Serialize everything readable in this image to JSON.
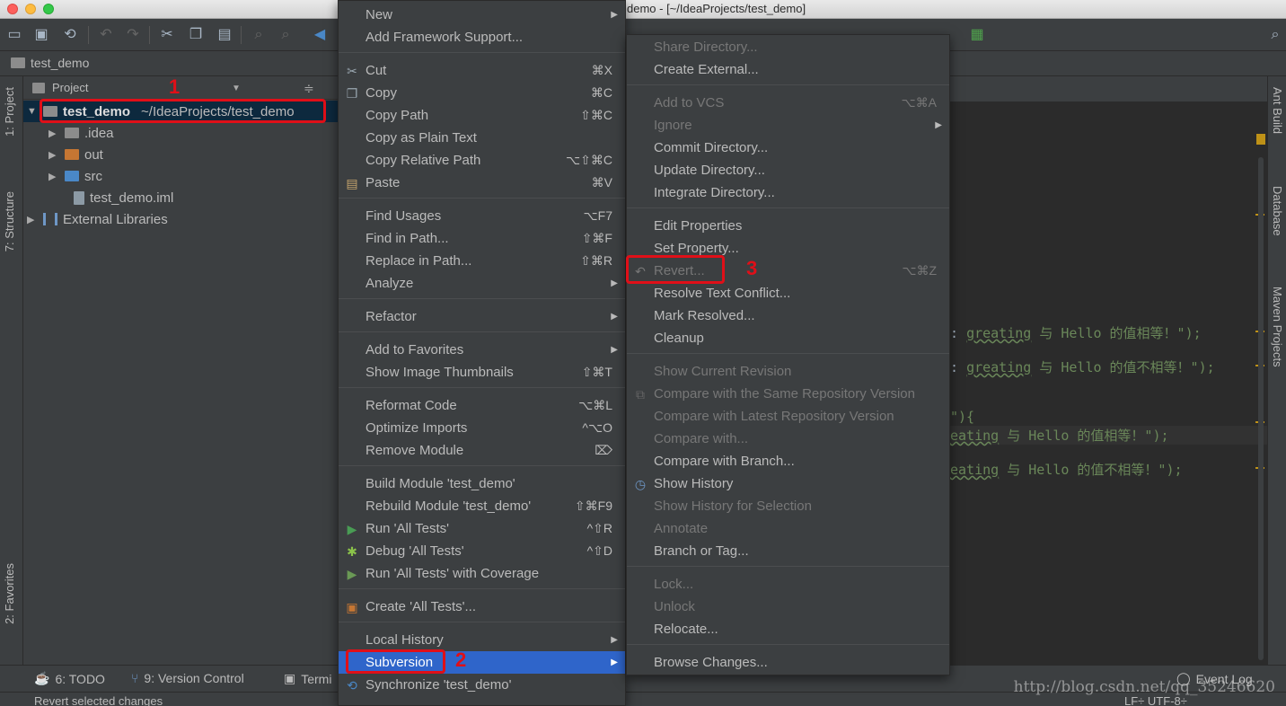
{
  "window": {
    "title": "demo - [~/IdeaProjects/test_demo]"
  },
  "navbar": {
    "crumb": "test_demo"
  },
  "left_strip": {
    "project_tab": "1: Project",
    "structure_tab": "7: Structure",
    "favorites_tab": "2: Favorites"
  },
  "right_strip": {
    "ant_tab": "Ant Build",
    "database_tab": "Database",
    "maven_tab": "Maven Projects"
  },
  "project": {
    "header": "Project",
    "root_name": "test_demo",
    "root_path": "~/IdeaProjects/test_demo",
    "items": [
      {
        "label": ".idea",
        "icon": "folder-icon"
      },
      {
        "label": "out",
        "icon": "folder-orange-icon"
      },
      {
        "label": "src",
        "icon": "folder-blue-icon"
      },
      {
        "label": "test_demo.iml",
        "icon": "iml-file-icon"
      },
      {
        "label": "External Libraries",
        "icon": "library-icon"
      }
    ]
  },
  "annotations": {
    "a1": "1",
    "a2": "2",
    "a3": "3"
  },
  "context_menu": {
    "new": {
      "label": "New"
    },
    "add_framework": {
      "label": "Add Framework Support..."
    },
    "cut": {
      "label": "Cut",
      "shortcut": "⌘X"
    },
    "copy": {
      "label": "Copy",
      "shortcut": "⌘C"
    },
    "copy_path": {
      "label": "Copy Path",
      "shortcut": "⇧⌘C"
    },
    "copy_plain": {
      "label": "Copy as Plain Text"
    },
    "copy_relative": {
      "label": "Copy Relative Path",
      "shortcut": "⌥⇧⌘C"
    },
    "paste": {
      "label": "Paste",
      "shortcut": "⌘V"
    },
    "find_usages": {
      "label": "Find Usages",
      "shortcut": "⌥F7"
    },
    "find_in_path": {
      "label": "Find in Path...",
      "shortcut": "⇧⌘F"
    },
    "replace_in_path": {
      "label": "Replace in Path...",
      "shortcut": "⇧⌘R"
    },
    "analyze": {
      "label": "Analyze"
    },
    "refactor": {
      "label": "Refactor"
    },
    "add_favorites": {
      "label": "Add to Favorites"
    },
    "show_thumbnails": {
      "label": "Show Image Thumbnails",
      "shortcut": "⇧⌘T"
    },
    "reformat": {
      "label": "Reformat Code",
      "shortcut": "⌥⌘L"
    },
    "optimize": {
      "label": "Optimize Imports",
      "shortcut": "^⌥O"
    },
    "remove_module": {
      "label": "Remove Module",
      "shortcut": "⌦"
    },
    "build_module": {
      "label": "Build Module 'test_demo'"
    },
    "rebuild_module": {
      "label": "Rebuild Module 'test_demo'",
      "shortcut": "⇧⌘F9"
    },
    "run_tests": {
      "label": "Run 'All Tests'",
      "shortcut": "^⇧R"
    },
    "debug_tests": {
      "label": "Debug 'All Tests'",
      "shortcut": "^⇧D"
    },
    "run_coverage": {
      "label": "Run 'All Tests' with Coverage"
    },
    "create_tests": {
      "label": "Create 'All Tests'..."
    },
    "local_history": {
      "label": "Local History"
    },
    "subversion": {
      "label": "Subversion"
    },
    "synchronize": {
      "label": "Synchronize 'test_demo'"
    }
  },
  "submenu": {
    "share_dir": {
      "label": "Share Directory..."
    },
    "create_external": {
      "label": "Create External..."
    },
    "add_to_vcs": {
      "label": "Add to VCS",
      "shortcut": "⌥⌘A"
    },
    "ignore": {
      "label": "Ignore"
    },
    "commit_dir": {
      "label": "Commit Directory..."
    },
    "update_dir": {
      "label": "Update Directory..."
    },
    "integrate_dir": {
      "label": "Integrate Directory..."
    },
    "edit_props": {
      "label": "Edit Properties"
    },
    "set_prop": {
      "label": "Set Property..."
    },
    "revert": {
      "label": "Revert...",
      "shortcut": "⌥⌘Z"
    },
    "resolve_conflict": {
      "label": "Resolve Text Conflict..."
    },
    "mark_resolved": {
      "label": "Mark Resolved..."
    },
    "cleanup": {
      "label": "Cleanup"
    },
    "show_current_rev": {
      "label": "Show Current Revision"
    },
    "compare_same": {
      "label": "Compare with the Same Repository Version"
    },
    "compare_latest": {
      "label": "Compare with Latest Repository Version"
    },
    "compare_with": {
      "label": "Compare with..."
    },
    "compare_branch": {
      "label": "Compare with Branch..."
    },
    "show_history": {
      "label": "Show History"
    },
    "show_history_sel": {
      "label": "Show History for Selection"
    },
    "annotate": {
      "label": "Annotate"
    },
    "branch_tag": {
      "label": "Branch or Tag..."
    },
    "lock": {
      "label": "Lock..."
    },
    "unlock": {
      "label": "Unlock"
    },
    "relocate": {
      "label": "Relocate..."
    },
    "browse_changes": {
      "label": "Browse Changes..."
    }
  },
  "editor": {
    "line1_pre": ": ",
    "line1_var": "greating",
    "line1_post": " 与 Hello 的值相等！\");",
    "line2_pre": ": ",
    "line2_var": "greating",
    "line2_post": " 与 Hello 的值不相等！\");",
    "line3": "\"){",
    "line4_var": "eating",
    "line4_post": " 与 Hello 的值相等！\");",
    "line5_var": "eating",
    "line5_post": " 与 Hello 的值不相等！\");"
  },
  "bottombar": {
    "todo": "6: TODO",
    "vcs": "9: Version Control",
    "terminal": "Termi",
    "event_log": "Event Log"
  },
  "status": {
    "message": "Revert selected changes",
    "right": "LF÷ UTF-8÷"
  },
  "watermark": "http://blog.csdn.net/qq_35246620"
}
